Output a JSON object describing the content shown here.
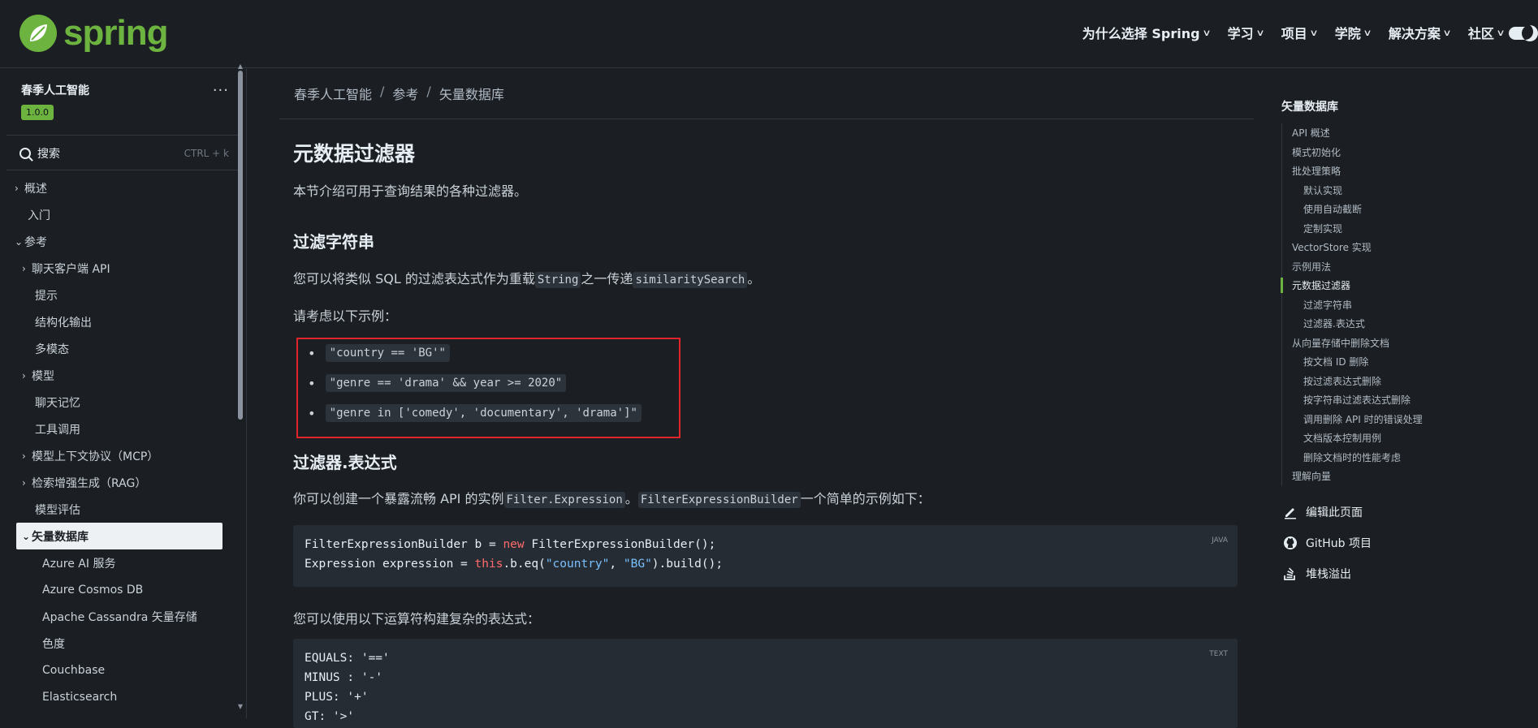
{
  "header": {
    "logo_text": "spring",
    "nav": [
      {
        "label": "为什么选择 Spring"
      },
      {
        "label": "学习"
      },
      {
        "label": "项目"
      },
      {
        "label": "学院"
      },
      {
        "label": "解决方案"
      },
      {
        "label": "社区"
      }
    ]
  },
  "sidebar": {
    "title": "春季人工智能",
    "version": "1.0.0",
    "more": "···",
    "search_label": "搜索",
    "search_shortcut": "CTRL + k",
    "items": [
      {
        "label": "概述",
        "caret": "›"
      },
      {
        "label": "入门"
      },
      {
        "label": "参考",
        "caret": "⌄"
      },
      {
        "label": "聊天客户端 API",
        "caret": "›"
      },
      {
        "label": "提示"
      },
      {
        "label": "结构化输出"
      },
      {
        "label": "多模态"
      },
      {
        "label": "模型",
        "caret": "›"
      },
      {
        "label": "聊天记忆"
      },
      {
        "label": "工具调用"
      },
      {
        "label": "模型上下文协议（MCP）",
        "caret": "›"
      },
      {
        "label": "检索增强生成（RAG）",
        "caret": "›"
      },
      {
        "label": "模型评估"
      },
      {
        "label": "矢量数据库",
        "caret": "⌄"
      },
      {
        "label": "Azure AI 服务"
      },
      {
        "label": "Azure Cosmos DB"
      },
      {
        "label": "Apache Cassandra 矢量存储"
      },
      {
        "label": "色度"
      },
      {
        "label": "Couchbase"
      },
      {
        "label": "Elasticsearch"
      }
    ]
  },
  "breadcrumb": [
    "春季人工智能",
    "参考",
    "矢量数据库"
  ],
  "main": {
    "title": "元数据过滤器",
    "intro": "本节介绍可用于查询结果的各种过滤器。",
    "section1_title": "过滤字符串",
    "section1_text_a": "您可以将类似 SQL 的过滤表达式作为重载",
    "section1_code_a": "String",
    "section1_text_b": "之一传递",
    "section1_code_b": "similaritySearch",
    "section1_text_c": "。",
    "examples_intro": "请考虑以下示例：",
    "examples": [
      "\"country == 'BG'\"",
      "\"genre == 'drama' && year >= 2020\"",
      "\"genre in ['comedy', 'documentary', 'drama']\""
    ],
    "section2_title": "过滤器.表达式",
    "section2_text_a": "你可以创建一个暴露流畅 API 的实例",
    "section2_code_a": "Filter.Expression",
    "section2_text_b": "。",
    "section2_code_b": "FilterExpressionBuilder",
    "section2_text_c": "一个简单的示例如下：",
    "code1_lang": "JAVA",
    "code1_l1_a": "FilterExpressionBuilder b = ",
    "code1_l1_kw": "new",
    "code1_l1_b": " FilterExpressionBuilder();",
    "code1_l2_a": "Expression expression = ",
    "code1_l2_kw": "this",
    "code1_l2_b": ".b.eq(",
    "code1_l2_s1": "\"country\"",
    "code1_l2_c": ", ",
    "code1_l2_s2": "\"BG\"",
    "code1_l2_d": ").build();",
    "operators_intro": "您可以使用以下运算符构建复杂的表达式：",
    "code2_lang": "TEXT",
    "code2_lines": [
      "EQUALS: '=='",
      "MINUS : '-'",
      "PLUS: '+'",
      "GT: '>'"
    ]
  },
  "toc": {
    "title": "矢量数据库",
    "items": [
      {
        "label": "API 概述"
      },
      {
        "label": "模式初始化"
      },
      {
        "label": "批处理策略"
      },
      {
        "label": "默认实现"
      },
      {
        "label": "使用自动截断"
      },
      {
        "label": "定制实现"
      },
      {
        "label": "VectorStore 实现"
      },
      {
        "label": "示例用法"
      },
      {
        "label": "元数据过滤器"
      },
      {
        "label": "过滤字符串"
      },
      {
        "label": "过滤器.表达式"
      },
      {
        "label": "从向量存储中删除文档"
      },
      {
        "label": "按文档 ID 删除"
      },
      {
        "label": "按过滤表达式删除"
      },
      {
        "label": "按字符串过滤表达式删除"
      },
      {
        "label": "调用删除 API 时的错误处理"
      },
      {
        "label": "文档版本控制用例"
      },
      {
        "label": "删除文档时的性能考虑"
      },
      {
        "label": "理解向量"
      }
    ],
    "links": [
      {
        "label": "编辑此页面",
        "icon": "edit-icon"
      },
      {
        "label": "GitHub 项目",
        "icon": "github-icon"
      },
      {
        "label": "堆栈溢出",
        "icon": "stackoverflow-icon"
      }
    ]
  },
  "colors": {
    "accent": "#6db33f",
    "highlight_box": "#e0242b",
    "background": "#1b1f23"
  }
}
